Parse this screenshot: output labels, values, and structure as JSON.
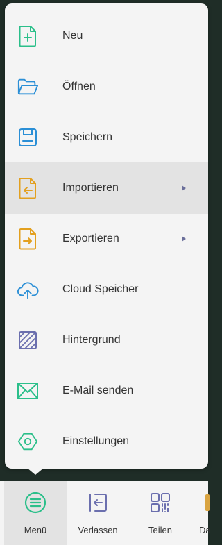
{
  "menu": {
    "items": [
      {
        "label": "Neu",
        "icon": "new-file-icon",
        "color": "#2bbf8a",
        "submenu": false
      },
      {
        "label": "Öffnen",
        "icon": "folder-open-icon",
        "color": "#2b8fd6",
        "submenu": false
      },
      {
        "label": "Speichern",
        "icon": "save-icon",
        "color": "#2b8fd6",
        "submenu": false
      },
      {
        "label": "Importieren",
        "icon": "import-icon",
        "color": "#e3a01f",
        "submenu": true
      },
      {
        "label": "Exportieren",
        "icon": "export-icon",
        "color": "#e3a01f",
        "submenu": true
      },
      {
        "label": "Cloud Speicher",
        "icon": "cloud-upload-icon",
        "color": "#2b8fd6",
        "submenu": false
      },
      {
        "label": "Hintergrund",
        "icon": "background-pattern-icon",
        "color": "#6b6fae",
        "submenu": false
      },
      {
        "label": "E-Mail senden",
        "icon": "mail-icon",
        "color": "#2bbf8a",
        "submenu": false
      },
      {
        "label": "Einstellungen",
        "icon": "settings-icon",
        "color": "#2bbf8a",
        "submenu": false
      }
    ],
    "highlighted_item": "Importieren"
  },
  "toolbar": {
    "menu_label": "Menü",
    "leave_label": "Verlassen",
    "share_label": "Teilen",
    "partial_label": "Da"
  },
  "colors": {
    "background": "#1f2d27",
    "panel": "#f4f4f4",
    "highlight": "#e3e3e3",
    "green": "#2bbf8a",
    "blue": "#2b8fd6",
    "orange": "#e3a01f",
    "purple": "#6b6fae",
    "text": "#333333"
  }
}
